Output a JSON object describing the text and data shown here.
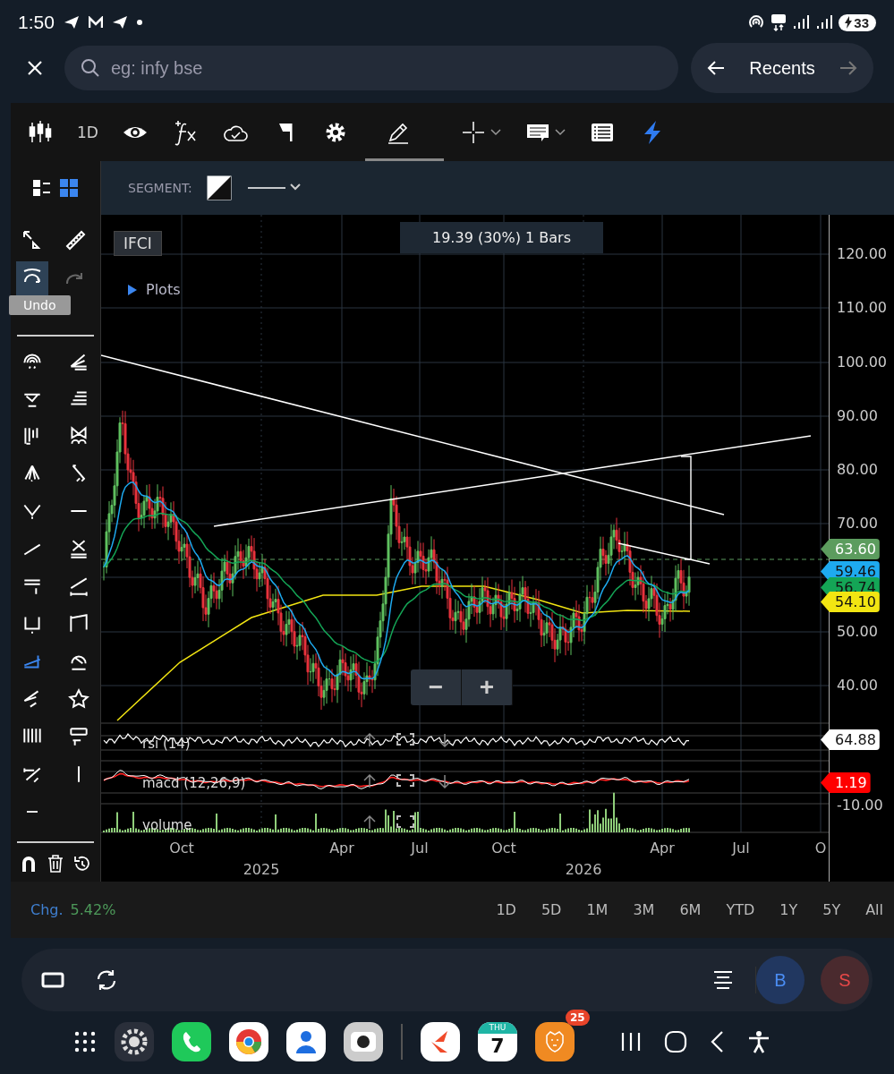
{
  "status_bar": {
    "time": "1:50",
    "battery": "33"
  },
  "search": {
    "placeholder": "eg: infy bse"
  },
  "recents": {
    "label": "Recents"
  },
  "toolbar": {
    "tools": [
      {
        "selected": false
      },
      {
        "label": "1D",
        "selected": false
      },
      {
        "selected": false
      },
      {
        "selected": false
      },
      {
        "selected": false
      },
      {
        "selected": false
      },
      {
        "selected": false
      },
      {
        "selected": true
      },
      {
        "selected": false
      },
      {
        "selected": false
      },
      {
        "selected": false
      },
      {
        "selected": false
      }
    ]
  },
  "view_toggle": [
    {
      "selected": false
    },
    {
      "selected": true
    }
  ],
  "edit_tools": [
    {
      "pressed": false,
      "disabled": false
    },
    {
      "pressed": false,
      "disabled": false
    },
    {
      "pressed": true,
      "disabled": false
    },
    {
      "pressed": false,
      "disabled": true
    }
  ],
  "undo_tooltip": "Undo",
  "drawing_tools": [
    {
      "selected": false
    },
    {
      "selected": false
    },
    {
      "selected": false
    },
    {
      "selected": false
    },
    {
      "selected": false
    },
    {
      "selected": false
    },
    {
      "selected": false
    },
    {
      "selected": false
    },
    {
      "selected": false
    },
    {
      "selected": false
    },
    {
      "selected": false
    },
    {
      "selected": false
    },
    {
      "selected": false
    },
    {
      "selected": false
    },
    {
      "selected": false
    },
    {
      "selected": false
    },
    {
      "selected": true
    },
    {
      "selected": false
    },
    {
      "selected": false
    },
    {
      "selected": false
    },
    {
      "selected": false
    },
    {
      "selected": false
    },
    {
      "selected": false
    },
    {
      "selected": false
    },
    {
      "selected": false
    }
  ],
  "segment_bar": {
    "label": "SEGMENT:"
  },
  "chart": {
    "symbol": "IFCI",
    "plots_label": "Plots",
    "measure": "19.39 (30%) 1 Bars",
    "y_labels": [
      "120.00",
      "110.00",
      "100.00",
      "90.00",
      "80.00",
      "70.00",
      "50.00",
      "40.00"
    ],
    "lower_y_label": "-10.00",
    "price_tags": [
      {
        "value": "63.60",
        "color": "#5c9c5e"
      },
      {
        "value": "59.46",
        "color": "#1eaaf0"
      },
      {
        "value": "56.74",
        "color": "#14a556"
      },
      {
        "value": "54.10",
        "color": "#f2e512"
      },
      {
        "value": "64.88",
        "color": "#ffffff"
      },
      {
        "value": "1.19",
        "color": "#ff0000"
      }
    ],
    "indicators": [
      "rsi (14)",
      "macd (12,26,9)",
      "volume"
    ],
    "x_labels": [
      "Oct",
      "Apr",
      "Jul",
      "Oct",
      "Apr",
      "Jul",
      "O"
    ],
    "year_labels": [
      "2025",
      "2026"
    ],
    "zoom_out": "−",
    "zoom_in": "+"
  },
  "footer": {
    "change_label": "Chg.",
    "change_value": "5.42%",
    "ranges": [
      "1D",
      "5D",
      "1M",
      "3M",
      "6M",
      "YTD",
      "1Y",
      "5Y",
      "All"
    ]
  },
  "order_buttons": [
    {
      "label": "B",
      "kind": "buy"
    },
    {
      "label": "S",
      "kind": "sell"
    }
  ],
  "dock": {
    "calendar_day": "THU",
    "calendar_date": "7",
    "badge": "25"
  }
}
